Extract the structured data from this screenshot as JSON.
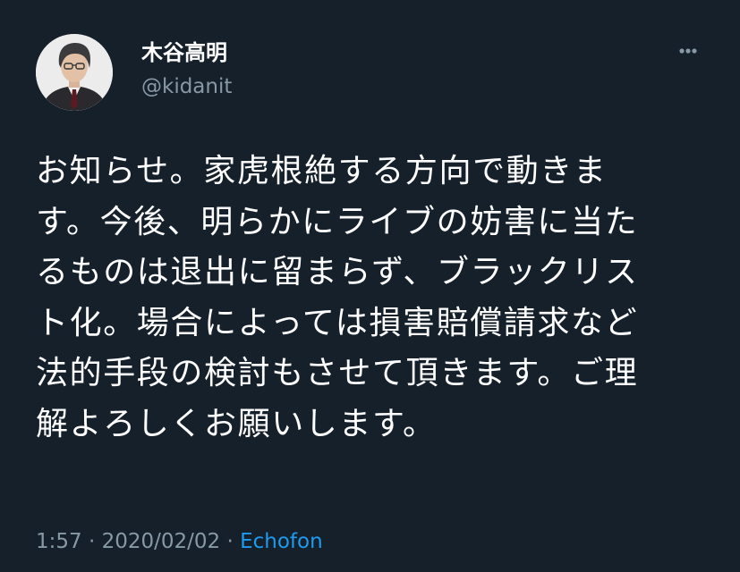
{
  "user": {
    "display_name": "木谷高明",
    "handle": "@kidanit",
    "avatar": "profile-photo"
  },
  "tweet": {
    "lines": [
      "お知らせ。家虎根絶する方向で動きま",
      "す。今後、明らかにライブの妨害に当た",
      "るものは退出に留まらず、ブラックリス",
      "ト化。場合によっては損害賠償請求など",
      "法的手段の検討もさせて頂きます。ご理",
      "解よろしくお願いします。"
    ]
  },
  "meta": {
    "time": "1:57",
    "separator": "·",
    "date": "2020/02/02",
    "source": "Echofon"
  },
  "icons": {
    "more": "more-options-icon"
  },
  "colors": {
    "background": "#15202b",
    "text": "#ffffff",
    "secondary": "#8899a6",
    "link": "#1d9bf0"
  }
}
